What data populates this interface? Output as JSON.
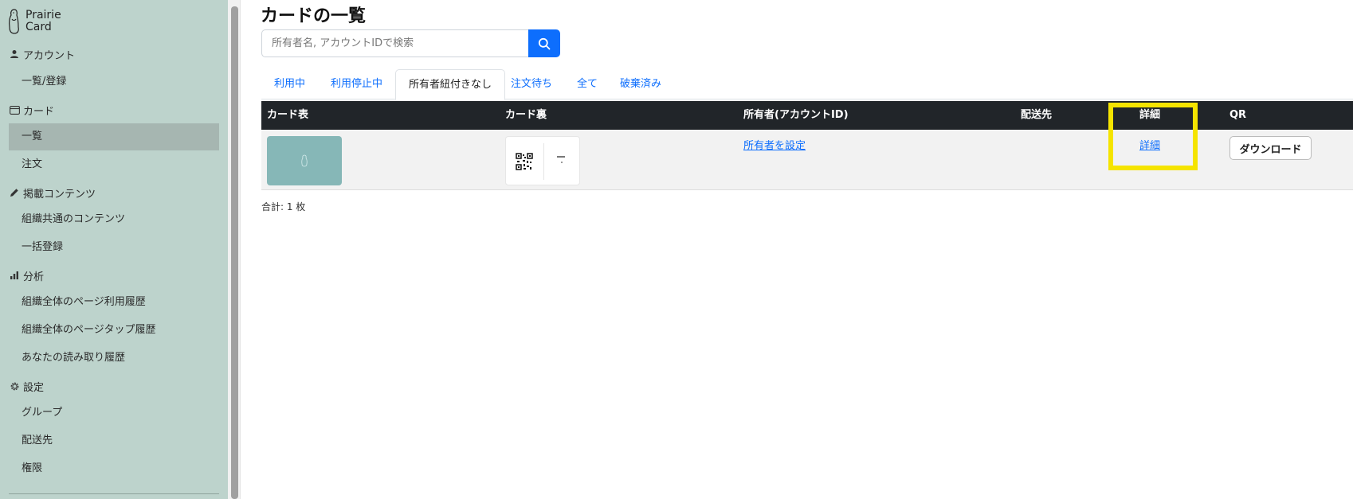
{
  "app": {
    "logo_line1": "Prairie",
    "logo_line2": "Card"
  },
  "sidebar": {
    "sections": [
      {
        "label": "アカウント",
        "icon": "person-icon",
        "items": [
          {
            "label": "一覧/登録"
          }
        ]
      },
      {
        "label": "カード",
        "icon": "card-icon",
        "items": [
          {
            "label": "一覧",
            "active": true
          },
          {
            "label": "注文"
          }
        ]
      },
      {
        "label": "掲載コンテンツ",
        "icon": "pencil-icon",
        "items": [
          {
            "label": "組織共通のコンテンツ"
          },
          {
            "label": "一括登録"
          }
        ]
      },
      {
        "label": "分析",
        "icon": "bar-chart-icon",
        "items": [
          {
            "label": "組織全体のページ利用履歴"
          },
          {
            "label": "組織全体のページタップ履歴"
          },
          {
            "label": "あなたの読み取り履歴"
          }
        ]
      },
      {
        "label": "設定",
        "icon": "gear-icon",
        "items": [
          {
            "label": "グループ"
          },
          {
            "label": "配送先"
          },
          {
            "label": "権限"
          }
        ]
      }
    ]
  },
  "main": {
    "title": "カードの一覧",
    "search": {
      "placeholder": "所有者名, アカウントIDで検索",
      "value": ""
    },
    "tabs": [
      {
        "label": "利用中"
      },
      {
        "label": "利用停止中"
      },
      {
        "label": "所有者紐付きなし",
        "active": true
      },
      {
        "label": "注文待ち"
      },
      {
        "label": "全て"
      },
      {
        "label": "破棄済み"
      }
    ],
    "table": {
      "headers": [
        "カード表",
        "カード裏",
        "所有者(アカウントID)",
        "配送先",
        "詳細",
        "QR"
      ],
      "rows": [
        {
          "owner_link": "所有者を設定",
          "detail_link": "詳細",
          "qr_button": "ダウンロード"
        }
      ]
    },
    "total": "合計: 1 枚"
  },
  "colors": {
    "sidebar_bg": "#bdd3cc",
    "active_item_bg": "#a6b6b1",
    "accent": "#0d6efd",
    "table_header_bg": "#212529",
    "highlight": "#f5e400",
    "card_front": "#86b7b7"
  }
}
